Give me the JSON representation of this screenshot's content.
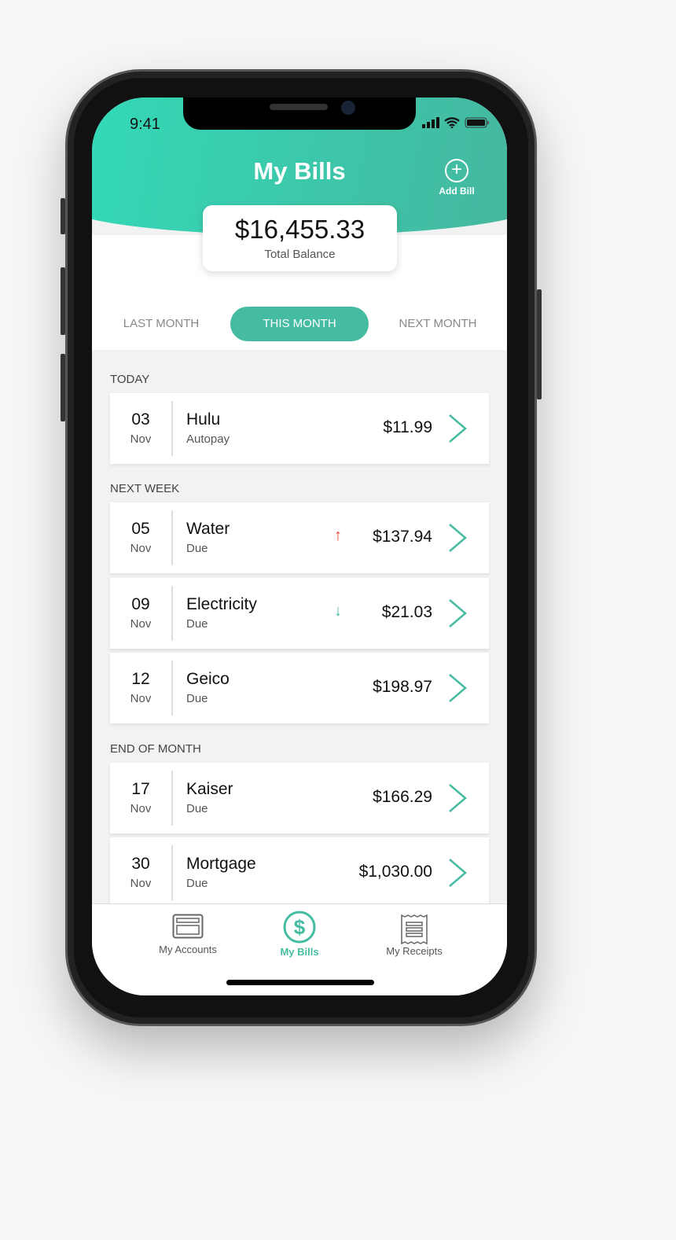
{
  "status": {
    "time": "9:41"
  },
  "header": {
    "title": "My Bills",
    "add_label": "Add Bill"
  },
  "balance": {
    "amount": "$16,455.33",
    "label": "Total Balance"
  },
  "tabs": [
    {
      "label": "LAST MONTH"
    },
    {
      "label": "THIS MONTH",
      "active": true
    },
    {
      "label": "NEXT MONTH"
    }
  ],
  "sections": [
    {
      "title": "TODAY",
      "bills": [
        {
          "day": "03",
          "month": "Nov",
          "name": "Hulu",
          "status": "Autopay",
          "amount": "$11.99",
          "trend": ""
        }
      ]
    },
    {
      "title": "NEXT WEEK",
      "bills": [
        {
          "day": "05",
          "month": "Nov",
          "name": "Water",
          "status": "Due",
          "amount": "$137.94",
          "trend": "up"
        },
        {
          "day": "09",
          "month": "Nov",
          "name": "Electricity",
          "status": "Due",
          "amount": "$21.03",
          "trend": "down"
        },
        {
          "day": "12",
          "month": "Nov",
          "name": "Geico",
          "status": "Due",
          "amount": "$198.97",
          "trend": ""
        }
      ]
    },
    {
      "title": "END OF MONTH",
      "bills": [
        {
          "day": "17",
          "month": "Nov",
          "name": "Kaiser",
          "status": "Due",
          "amount": "$166.29",
          "trend": ""
        },
        {
          "day": "30",
          "month": "Nov",
          "name": "Mortgage",
          "status": "Due",
          "amount": "$1,030.00",
          "trend": ""
        }
      ]
    }
  ],
  "tabbar": [
    {
      "label": "My Accounts",
      "icon": "card-icon"
    },
    {
      "label": "My Bills",
      "icon": "dollar-circle-icon",
      "active": true
    },
    {
      "label": "My Receipts",
      "icon": "receipt-icon"
    }
  ],
  "colors": {
    "accent": "#45bca2",
    "up": "#e8452c",
    "down": "#45bca2"
  }
}
